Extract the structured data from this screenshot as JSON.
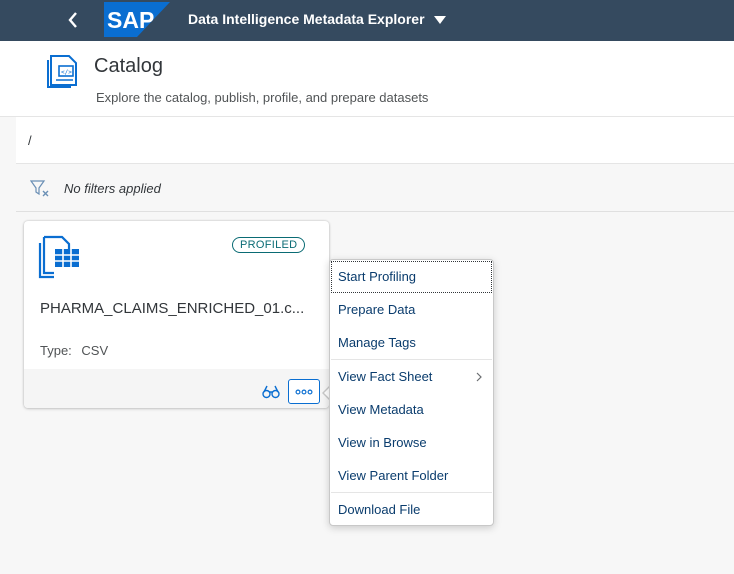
{
  "shellbar": {
    "logo_text": "SAP",
    "app_title": "Data Intelligence Metadata Explorer",
    "bg_color": "#354a5f",
    "logo_color": "#0a6ed1"
  },
  "header": {
    "title": "Catalog",
    "subtitle": "Explore the catalog, publish, profile, and prepare datasets",
    "icon": "catalog-icon"
  },
  "path": {
    "value": "/"
  },
  "filter": {
    "text": "No filters applied",
    "icon": "filter-clear-icon"
  },
  "card": {
    "badge": "PROFILED",
    "name": "PHARMA_CLAIMS_ENRICHED_01.c...",
    "type_label": "Type:",
    "type_value": "CSV",
    "icon": "table-file-icon",
    "actions": [
      "binoculars-icon",
      "more-icon"
    ]
  },
  "menu": {
    "items": [
      {
        "label": "Start Profiling"
      },
      {
        "label": "Prepare Data"
      },
      {
        "label": "Manage Tags"
      },
      {
        "label": "View Fact Sheet",
        "submenu": true
      },
      {
        "label": "View Metadata"
      },
      {
        "label": "View in Browse"
      },
      {
        "label": "View Parent Folder"
      },
      {
        "label": "Download File"
      }
    ]
  },
  "colors": {
    "accent": "#0a6ed1",
    "badge": "#0a6b74",
    "link": "#0a3c6d"
  }
}
